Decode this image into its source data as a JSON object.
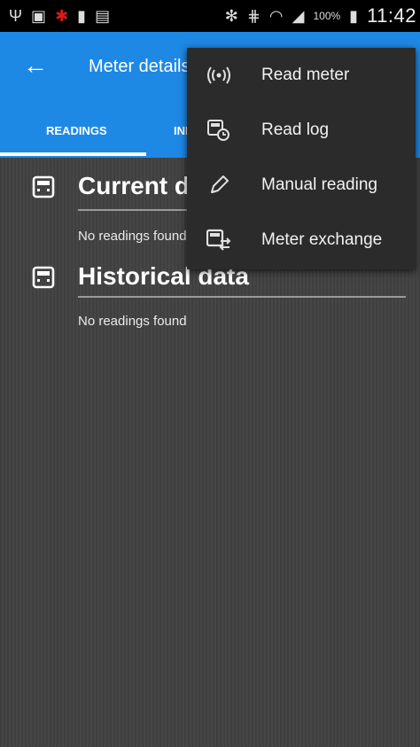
{
  "status_bar": {
    "battery_percent": "100%",
    "time": "11:42"
  },
  "app_bar": {
    "title": "Meter details",
    "tabs": [
      {
        "label": "READINGS",
        "selected": true
      },
      {
        "label": "INFO",
        "selected": false
      }
    ]
  },
  "sections": [
    {
      "title": "Current data",
      "empty_text": "No readings found"
    },
    {
      "title": "Historical data",
      "empty_text": "No readings found"
    }
  ],
  "overflow_menu": {
    "items": [
      {
        "label": "Read meter",
        "icon": "radio-waves-icon"
      },
      {
        "label": "Read log",
        "icon": "log-clock-icon"
      },
      {
        "label": "Manual reading",
        "icon": "pencil-icon"
      },
      {
        "label": "Meter exchange",
        "icon": "meter-exchange-icon"
      }
    ]
  },
  "colors": {
    "primary": "#1e88e5",
    "status_bar": "#000000",
    "menu_background": "#2b2b2b",
    "content_background": "#424242"
  }
}
